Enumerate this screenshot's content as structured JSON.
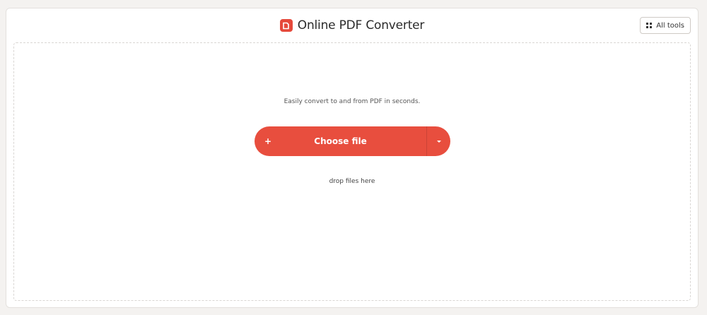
{
  "header": {
    "title": "Online PDF Converter",
    "logo_icon": "pdf-logo-icon",
    "all_tools_label": "All tools",
    "all_tools_icon": "grid-icon"
  },
  "main": {
    "tagline": "Easily convert to and from PDF in seconds.",
    "choose_file_label": "Choose file",
    "plus_symbol": "+",
    "dropdown_icon": "chevron-down-icon",
    "drop_hint": "drop files here"
  },
  "colors": {
    "accent": "#e84e3e",
    "logo": "#e5493b",
    "page_background": "#f4f2f0"
  }
}
